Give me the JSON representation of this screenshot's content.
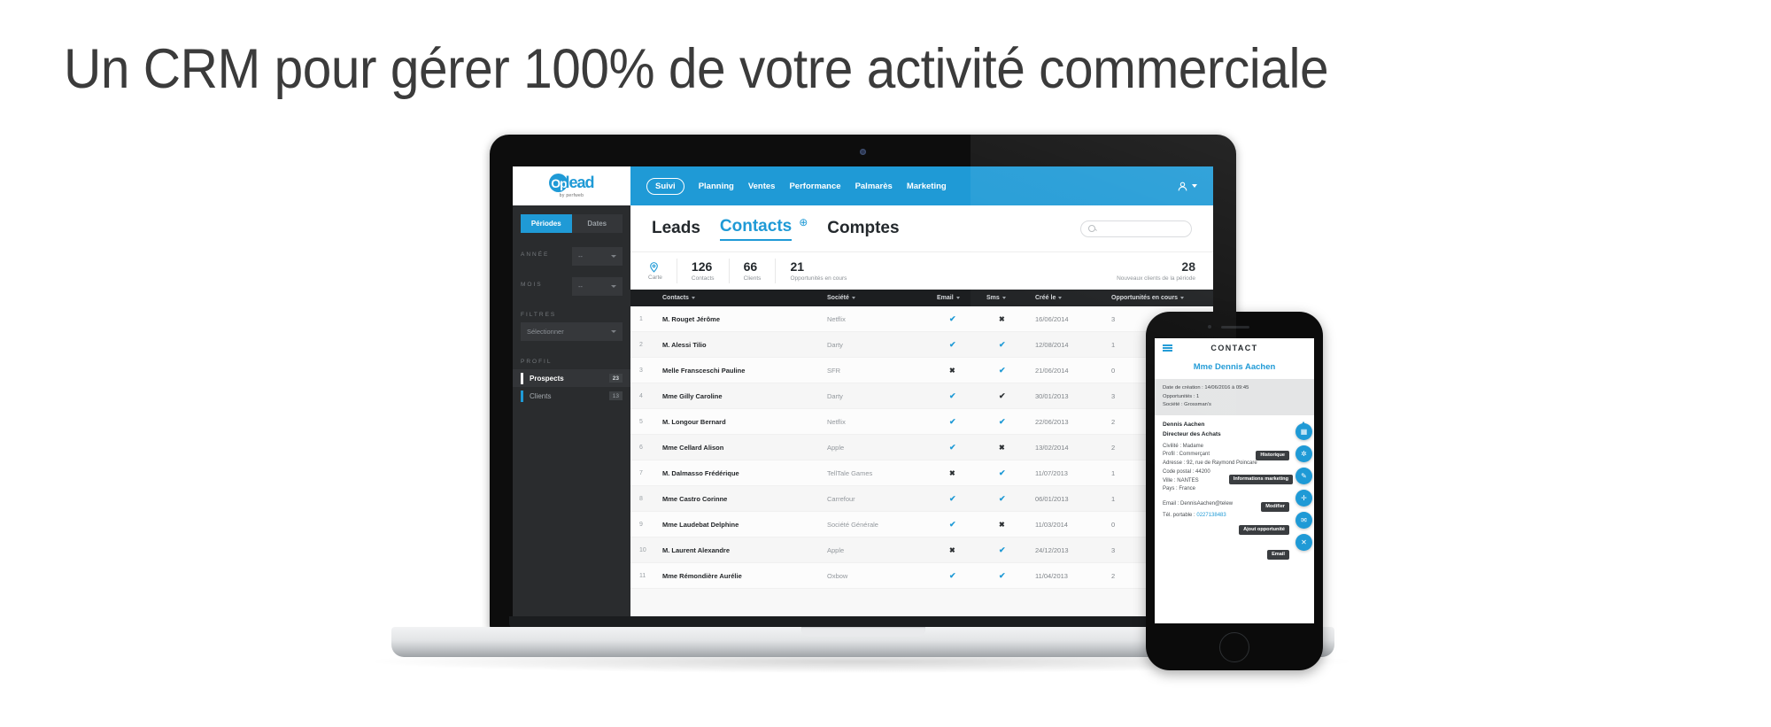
{
  "headline": "Un CRM pour gérer 100% de votre activité commerciale",
  "app": {
    "logo": {
      "o": "Op",
      "rest": "lead",
      "sub": "by perfweb"
    },
    "nav": [
      {
        "label": "Suivi",
        "active": true
      },
      {
        "label": "Planning",
        "active": false
      },
      {
        "label": "Ventes",
        "active": false
      },
      {
        "label": "Performance",
        "active": false
      },
      {
        "label": "Palmarès",
        "active": false
      },
      {
        "label": "Marketing",
        "active": false
      }
    ],
    "user_icon": "user-icon",
    "sidebar": {
      "segments": [
        {
          "label": "Périodes",
          "active": true
        },
        {
          "label": "Dates",
          "active": false
        }
      ],
      "year_label": "ANNÉE",
      "year_value": "--",
      "month_label": "MOIS",
      "month_value": "--",
      "filters_label": "FILTRES",
      "filters_value": "Sélectionner",
      "profile_label": "PROFIL",
      "profiles": [
        {
          "label": "Prospects",
          "count": "23",
          "active": true
        },
        {
          "label": "Clients",
          "count": "13",
          "active": false
        }
      ]
    },
    "tabs": [
      {
        "label": "Leads",
        "active": false
      },
      {
        "label": "Contacts",
        "active": true
      },
      {
        "label": "Comptes",
        "active": false
      }
    ],
    "add_icon": "plus-circle-icon",
    "search_placeholder": "",
    "stats": [
      {
        "value": "",
        "label": "Carte",
        "icon": "map-pin-icon"
      },
      {
        "value": "126",
        "label": "Contacts"
      },
      {
        "value": "66",
        "label": "Clients"
      },
      {
        "value": "21",
        "label": "Opportunités en cours"
      }
    ],
    "stat_right": {
      "value": "28",
      "label": "Nouveaux clients de la période"
    },
    "table": {
      "columns": [
        "",
        "Contacts",
        "Société",
        "Email",
        "Sms",
        "Créé le",
        "Opportunités en cours"
      ],
      "rows": [
        {
          "n": "1",
          "contact": "M. Rouget Jérôme",
          "societe": "Netflix",
          "email": "check",
          "sms": "cross",
          "date": "16/06/2014",
          "opp": "3"
        },
        {
          "n": "2",
          "contact": "M. Alessi Tilio",
          "societe": "Darty",
          "email": "check",
          "sms": "check",
          "date": "12/08/2014",
          "opp": "1"
        },
        {
          "n": "3",
          "contact": "Melle Fransceschi Pauline",
          "societe": "SFR",
          "email": "cross",
          "sms": "check",
          "date": "21/06/2014",
          "opp": "0"
        },
        {
          "n": "4",
          "contact": "Mme Gilly Caroline",
          "societe": "Darty",
          "email": "check",
          "sms": "checkg",
          "date": "30/01/2013",
          "opp": "3"
        },
        {
          "n": "5",
          "contact": "M. Longour Bernard",
          "societe": "Netflix",
          "email": "check",
          "sms": "check",
          "date": "22/06/2013",
          "opp": "2"
        },
        {
          "n": "6",
          "contact": "Mme Cellard Alison",
          "societe": "Apple",
          "email": "check",
          "sms": "cross",
          "date": "13/02/2014",
          "opp": "2"
        },
        {
          "n": "7",
          "contact": "M. Dalmasso Frédérique",
          "societe": "TellTale Games",
          "email": "cross",
          "sms": "check",
          "date": "11/07/2013",
          "opp": "1"
        },
        {
          "n": "8",
          "contact": "Mme Castro Corinne",
          "societe": "Carrefour",
          "email": "check",
          "sms": "check",
          "date": "06/01/2013",
          "opp": "1"
        },
        {
          "n": "9",
          "contact": "Mme Laudebat Delphine",
          "societe": "Société Générale",
          "email": "check",
          "sms": "cross",
          "date": "11/03/2014",
          "opp": "0"
        },
        {
          "n": "10",
          "contact": "M. Laurent Alexandre",
          "societe": "Apple",
          "email": "cross",
          "sms": "check",
          "date": "24/12/2013",
          "opp": "3"
        },
        {
          "n": "11",
          "contact": "Mme Rémondière Aurélie",
          "societe": "Oxbow",
          "email": "check",
          "sms": "check",
          "date": "11/04/2013",
          "opp": "2"
        }
      ]
    }
  },
  "phone": {
    "menu_icon": "hamburger-icon",
    "title": "CONTACT",
    "contact_name": "Mme Dennis Aachen",
    "meta": [
      "Date de création : 14/06/2016 à 09:45",
      "Opportunités : 1",
      "Société : Grossman's"
    ],
    "person": "Dennis Aachen",
    "role": "Directeur des Achats",
    "fields": [
      "Civilité : Madame",
      "Profil : Commerçant",
      "Adresse : 92, rue de Raymond Poincare",
      "Code postal : 44200",
      "Ville : NANTES",
      "Pays : France"
    ],
    "email_line": "Email : DennisAachen@telew",
    "phone_label": "Tél. portable : ",
    "phone_value": "0227138483",
    "tooltips": [
      "Historique",
      "Informations marketing",
      "Modifier",
      "Ajout opportunité",
      "Email"
    ],
    "actions": [
      "history-icon",
      "marketing-icon",
      "edit-pencil-icon",
      "add-opportunity-icon",
      "email-icon",
      "close-icon"
    ]
  },
  "colors": {
    "accent": "#1f9ad6",
    "dark": "#2a2c2e",
    "header_dark": "#1c1e20"
  }
}
